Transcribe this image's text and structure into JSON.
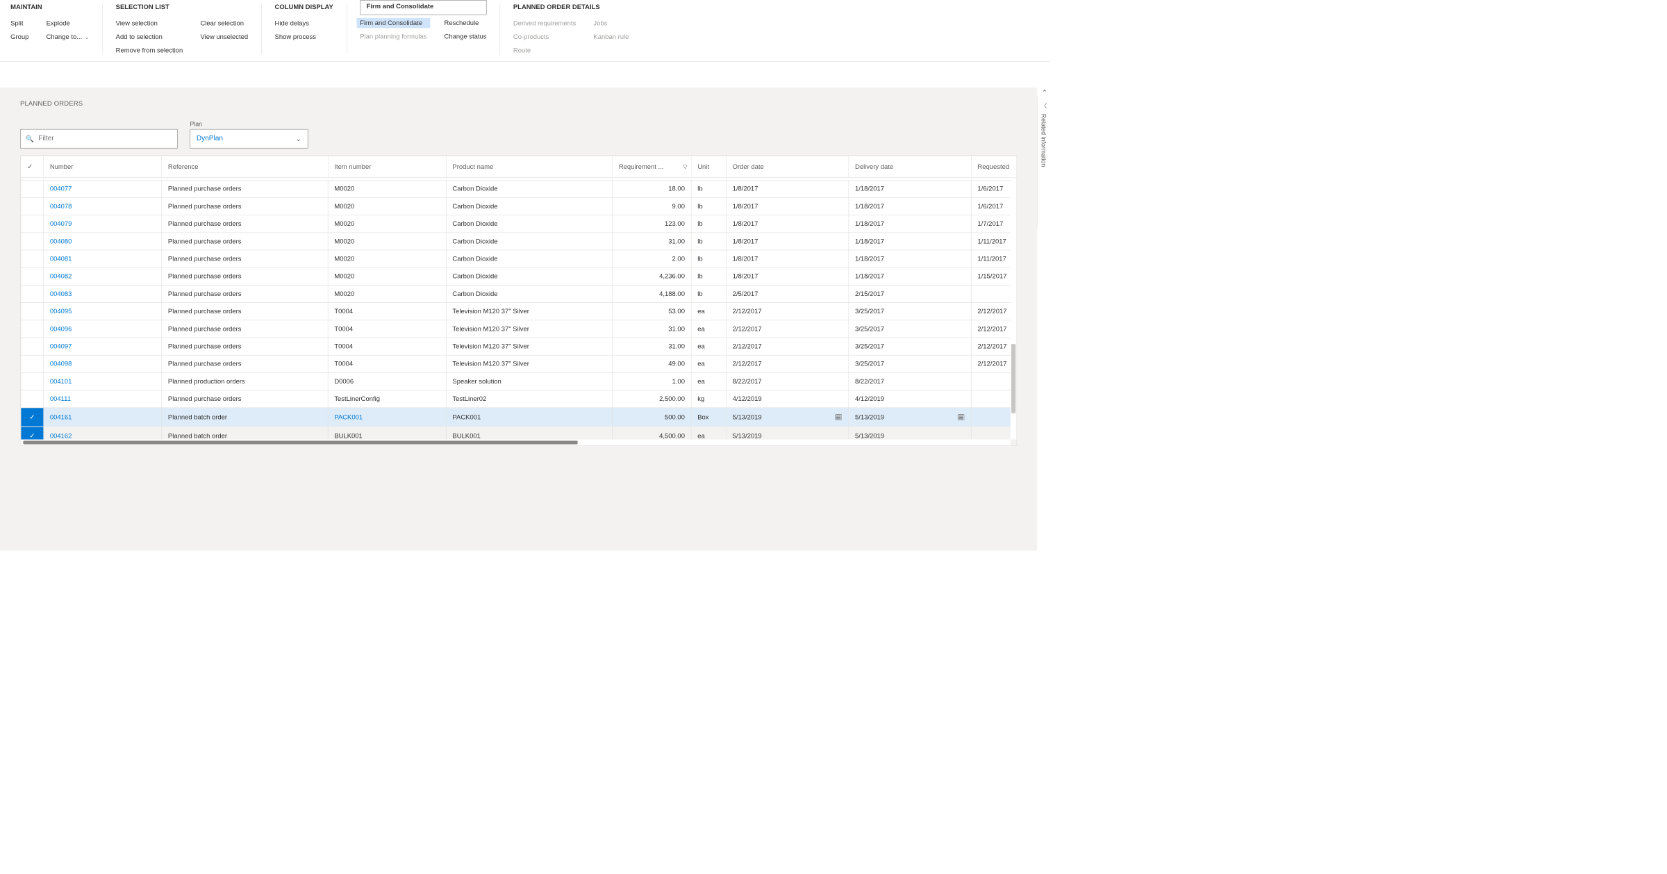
{
  "ribbon": {
    "groups": [
      {
        "title": "MAINTAIN",
        "cols": [
          [
            {
              "label": "Split"
            },
            {
              "label": "Group"
            }
          ],
          [
            {
              "label": "Explode"
            },
            {
              "label": "Change to...",
              "dropdown": true
            }
          ]
        ]
      },
      {
        "title": "SELECTION LIST",
        "cols": [
          [
            {
              "label": "View selection"
            },
            {
              "label": "Add to selection"
            },
            {
              "label": "Remove from selection"
            }
          ],
          [
            {
              "label": "Clear selection"
            },
            {
              "label": "View unselected"
            }
          ]
        ]
      },
      {
        "title": "COLUMN DISPLAY",
        "cols": [
          [
            {
              "label": "Hide delays"
            },
            {
              "label": "Show process"
            }
          ]
        ]
      },
      {
        "tab": "Firm and Consolidate",
        "cols": [
          [
            {
              "label": "Firm and Consolidate",
              "highlight": true
            },
            {
              "label": "Plan planning formulas",
              "disabled": true
            }
          ],
          [
            {
              "label": "Reschedule"
            },
            {
              "label": "Change status"
            }
          ]
        ]
      },
      {
        "title": "PLANNED ORDER DETAILS",
        "cols": [
          [
            {
              "label": "Derived requirements",
              "disabled": true
            },
            {
              "label": "Co-products",
              "disabled": true
            },
            {
              "label": "Route",
              "disabled": true
            }
          ],
          [
            {
              "label": "Jobs",
              "disabled": true
            },
            {
              "label": "Kanban rule",
              "disabled": true
            }
          ]
        ]
      }
    ]
  },
  "side_tab": "Related information",
  "main": {
    "title": "PLANNED ORDERS",
    "filter_placeholder": "Filter",
    "plan_label": "Plan",
    "plan_value": "DynPlan"
  },
  "grid": {
    "columns": [
      {
        "key": "chk",
        "label": "",
        "cls": "col-chk"
      },
      {
        "key": "number",
        "label": "Number",
        "cls": "col-num"
      },
      {
        "key": "reference",
        "label": "Reference",
        "cls": "col-ref"
      },
      {
        "key": "item",
        "label": "Item number",
        "cls": "col-item"
      },
      {
        "key": "product",
        "label": "Product name",
        "cls": "col-prod"
      },
      {
        "key": "qty",
        "label": "Requirement ...",
        "cls": "col-qty",
        "filter": true
      },
      {
        "key": "unit",
        "label": "Unit",
        "cls": "col-unit"
      },
      {
        "key": "order",
        "label": "Order date",
        "cls": "col-order"
      },
      {
        "key": "delivery",
        "label": "Delivery date",
        "cls": "col-deliv"
      },
      {
        "key": "requested",
        "label": "Requested",
        "cls": "col-req"
      }
    ],
    "rows": [
      {
        "number": "004077",
        "reference": "Planned purchase orders",
        "item": "M0020",
        "product": "Carbon Dioxide",
        "qty": "18.00",
        "unit": "lb",
        "order": "1/8/2017",
        "delivery": "1/18/2017",
        "requested": "1/6/2017"
      },
      {
        "number": "004078",
        "reference": "Planned purchase orders",
        "item": "M0020",
        "product": "Carbon Dioxide",
        "qty": "9.00",
        "unit": "lb",
        "order": "1/8/2017",
        "delivery": "1/18/2017",
        "requested": "1/6/2017"
      },
      {
        "number": "004079",
        "reference": "Planned purchase orders",
        "item": "M0020",
        "product": "Carbon Dioxide",
        "qty": "123.00",
        "unit": "lb",
        "order": "1/8/2017",
        "delivery": "1/18/2017",
        "requested": "1/7/2017"
      },
      {
        "number": "004080",
        "reference": "Planned purchase orders",
        "item": "M0020",
        "product": "Carbon Dioxide",
        "qty": "31.00",
        "unit": "lb",
        "order": "1/8/2017",
        "delivery": "1/18/2017",
        "requested": "1/11/2017"
      },
      {
        "number": "004081",
        "reference": "Planned purchase orders",
        "item": "M0020",
        "product": "Carbon Dioxide",
        "qty": "2.00",
        "unit": "lb",
        "order": "1/8/2017",
        "delivery": "1/18/2017",
        "requested": "1/11/2017"
      },
      {
        "number": "004082",
        "reference": "Planned purchase orders",
        "item": "M0020",
        "product": "Carbon Dioxide",
        "qty": "4,236.00",
        "unit": "lb",
        "order": "1/8/2017",
        "delivery": "1/18/2017",
        "requested": "1/15/2017"
      },
      {
        "number": "004083",
        "reference": "Planned purchase orders",
        "item": "M0020",
        "product": "Carbon Dioxide",
        "qty": "4,188.00",
        "unit": "lb",
        "order": "2/5/2017",
        "delivery": "2/15/2017",
        "requested": ""
      },
      {
        "number": "004095",
        "reference": "Planned purchase orders",
        "item": "T0004",
        "product": "Television M120 37\" Silver",
        "qty": "53.00",
        "unit": "ea",
        "order": "2/12/2017",
        "delivery": "3/25/2017",
        "requested": "2/12/2017"
      },
      {
        "number": "004096",
        "reference": "Planned purchase orders",
        "item": "T0004",
        "product": "Television M120 37\" Silver",
        "qty": "31.00",
        "unit": "ea",
        "order": "2/12/2017",
        "delivery": "3/25/2017",
        "requested": "2/12/2017"
      },
      {
        "number": "004097",
        "reference": "Planned purchase orders",
        "item": "T0004",
        "product": "Television M120 37\" Silver",
        "qty": "31.00",
        "unit": "ea",
        "order": "2/12/2017",
        "delivery": "3/25/2017",
        "requested": "2/12/2017"
      },
      {
        "number": "004098",
        "reference": "Planned purchase orders",
        "item": "T0004",
        "product": "Television M120 37\" Silver",
        "qty": "49.00",
        "unit": "ea",
        "order": "2/12/2017",
        "delivery": "3/25/2017",
        "requested": "2/12/2017"
      },
      {
        "number": "004101",
        "reference": "Planned production orders",
        "item": "D0006",
        "product": "Speaker solution",
        "qty": "1.00",
        "unit": "ea",
        "order": "8/22/2017",
        "delivery": "8/22/2017",
        "requested": ""
      },
      {
        "number": "004111",
        "reference": "Planned purchase orders",
        "item": "TestLinerConfig",
        "product": "TestLiner02",
        "qty": "2,500.00",
        "unit": "kg",
        "order": "4/12/2019",
        "delivery": "4/12/2019",
        "requested": ""
      },
      {
        "number": "004161",
        "reference": "Planned batch order",
        "item": "PACK001",
        "product": "PACK001",
        "qty": "500.00",
        "unit": "Box",
        "order": "5/13/2019",
        "delivery": "5/13/2019",
        "requested": "",
        "selected": "sel",
        "item_link": true,
        "cal": true
      },
      {
        "number": "004162",
        "reference": "Planned batch order",
        "item": "BULK001",
        "product": "BULK001",
        "qty": "4,500.00",
        "unit": "ea",
        "order": "5/13/2019",
        "delivery": "5/13/2019",
        "requested": "",
        "selected": "sel2"
      }
    ]
  }
}
